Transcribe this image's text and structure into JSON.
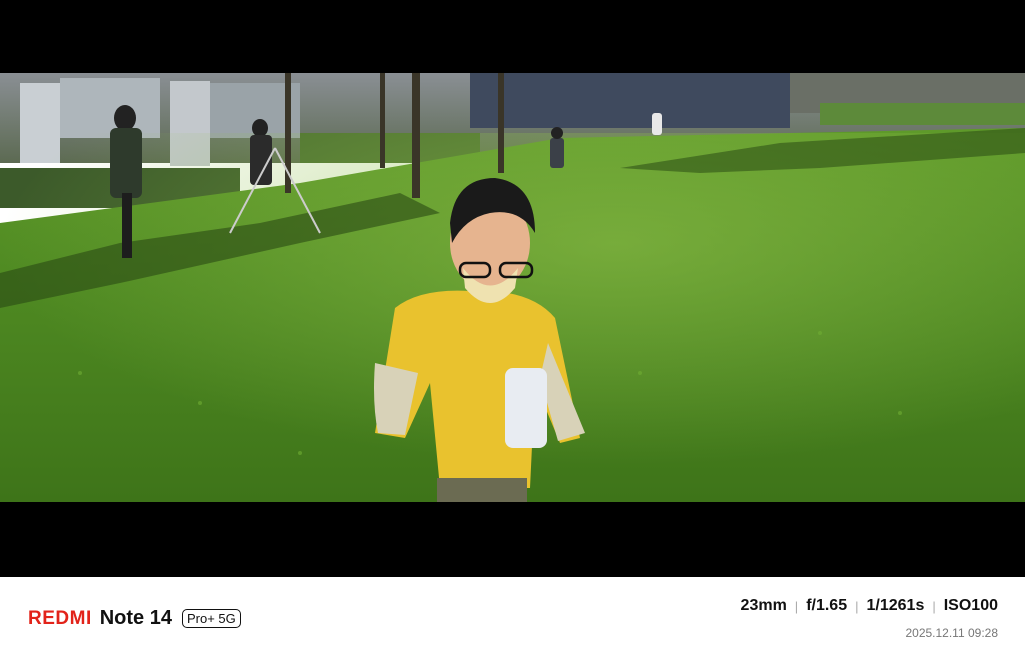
{
  "photo": {
    "subject": "photo-scene"
  },
  "watermark": {
    "brand": "REDMI",
    "model": "Note 14",
    "badge": "Pro+ 5G",
    "focal_length": "23mm",
    "aperture": "f/1.65",
    "shutter": "1/1261s",
    "iso": "ISO100",
    "datetime": "2025.12.11 09:28",
    "brand_color": "#e2231a"
  }
}
